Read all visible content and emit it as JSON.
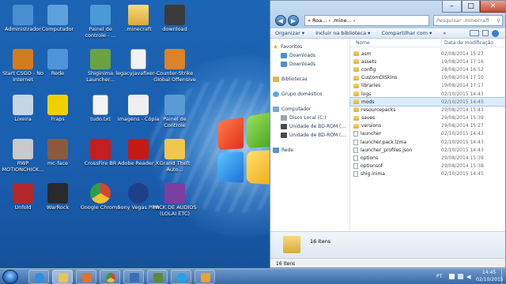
{
  "desktop": {
    "icons": [
      {
        "label": "Administrador",
        "color": "#4a8ed2",
        "kind": "user"
      },
      {
        "label": "Computador",
        "color": "#5fa0de",
        "kind": "pc"
      },
      {
        "label": "Painel de controle - ...",
        "color": "#4a9ad8",
        "kind": "cpl"
      },
      {
        "label": ".minecraft",
        "color": "#e0b44c",
        "kind": "folder"
      },
      {
        "label": "download",
        "color": "#3b3b3b",
        "kind": "dl"
      },
      {
        "label": "Start CSGO - No Internet",
        "color": "#d47b1e",
        "kind": "cs"
      },
      {
        "label": "Rede",
        "color": "#4f93d8",
        "kind": "net"
      },
      {
        "label": "Shiginima Launcher...",
        "color": "#6aa241",
        "kind": "mc"
      },
      {
        "label": "legacyjavafixer-...",
        "color": "#f2f2f2",
        "kind": "file"
      },
      {
        "label": "Counter-Strike Global Offensive",
        "color": "#d9832a",
        "kind": "cs"
      },
      {
        "label": "Lixeira",
        "color": "#c4d6e6",
        "kind": "bin"
      },
      {
        "label": "Fraps",
        "color": "#f2d000",
        "kind": "fraps"
      },
      {
        "label": "tudo.txt",
        "color": "#f4f4f4",
        "kind": "txt"
      },
      {
        "label": "imagens - Cópia",
        "color": "#efefef",
        "kind": "shot"
      },
      {
        "label": "Painel de Controle",
        "color": "#5a9bd5",
        "kind": "cpl"
      },
      {
        "label": "RWP MOTIONCHICK...",
        "color": "#c9c9c9",
        "kind": "mp3"
      },
      {
        "label": "mc-face",
        "color": "#8a5a3a",
        "kind": "mcf"
      },
      {
        "label": "CrossFire BR",
        "color": "#c21f1f",
        "kind": "cf"
      },
      {
        "label": "Adobe Reader X",
        "color": "#c41a14",
        "kind": "pdf"
      },
      {
        "label": "Grand Theft Auto...",
        "color": "#efc84a",
        "kind": "gta"
      },
      {
        "label": "Unfold",
        "color": "#b3272b",
        "kind": "rar"
      },
      {
        "label": "WarRock",
        "color": "#2a2a2a",
        "kind": "wr"
      },
      {
        "label": "Google Chrome",
        "color": "#d94334",
        "kind": "chrome"
      },
      {
        "label": "Sony Vegas PRO",
        "color": "#1f3f8a",
        "kind": "vegas"
      },
      {
        "label": "PACK DE AUDIOS (LOLAI ETC)",
        "color": "#7b3fa0",
        "kind": "rar"
      }
    ]
  },
  "explorer": {
    "breadcrumb": "« Roa... › .mine... ›",
    "search_placeholder": "Pesquisar .minecraft",
    "toolbar": {
      "organize": "Organizar ▾",
      "include": "Incluir na biblioteca ▾",
      "share": "Compartilhar com ▾",
      "more": "»"
    },
    "nav": {
      "favorites": "Favoritos",
      "downloads": "Downloads",
      "downloads2": "Downloads",
      "libraries": "Bibliotecas",
      "homegroup": "Grupo doméstico",
      "computer": "Computador",
      "disk_c": "Disco Local (C:)",
      "bd1": "Unidade de BD-ROM (...",
      "bd2": "Unidade de BD-ROM (...",
      "network": "Rede"
    },
    "columns": {
      "name": "Nome",
      "date": "Data de modificação"
    },
    "files": [
      {
        "name": "asm",
        "date": "02/08/2014 15:27",
        "type": "folder"
      },
      {
        "name": "assets",
        "date": "19/08/2014 17:16",
        "type": "folder"
      },
      {
        "name": "config",
        "date": "28/08/2014 16:52",
        "type": "folder"
      },
      {
        "name": "CustomDISkins",
        "date": "19/08/2014 17:10",
        "type": "folder"
      },
      {
        "name": "libraries",
        "date": "19/08/2014 17:17",
        "type": "folder"
      },
      {
        "name": "logs",
        "date": "02/10/2015 14:43",
        "type": "folder"
      },
      {
        "name": "mods",
        "date": "02/10/2015 14:45",
        "type": "folder",
        "selected": true
      },
      {
        "name": "resourcepacks",
        "date": "29/08/2014 15:43",
        "type": "folder"
      },
      {
        "name": "saves",
        "date": "29/08/2014 15:39",
        "type": "folder"
      },
      {
        "name": "versions",
        "date": "29/08/2014 15:27",
        "type": "folder"
      },
      {
        "name": "launcher",
        "date": "02/10/2015 14:43",
        "type": "file"
      },
      {
        "name": "launcher.pack.lzma",
        "date": "02/10/2015 14:43",
        "type": "file"
      },
      {
        "name": "launcher_profiles.json",
        "date": "02/10/2015 14:43",
        "type": "file"
      },
      {
        "name": "options",
        "date": "29/08/2014 15:39",
        "type": "file"
      },
      {
        "name": "optionsof",
        "date": "29/08/2014 15:38",
        "type": "file"
      },
      {
        "name": "shig.inima",
        "date": "02/10/2015 14:45",
        "type": "file"
      }
    ],
    "details": "16 itens",
    "status": "16 itens"
  },
  "taskbar": {
    "lang": "PT",
    "time": "14:45",
    "date": "02/10/2015"
  }
}
